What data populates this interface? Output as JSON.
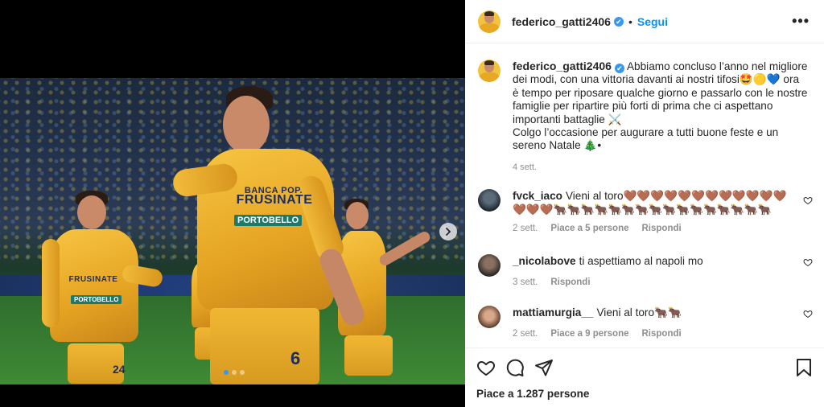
{
  "post": {
    "username": "federico_gatti2406",
    "follow_label": "Segui",
    "more_label": "•••",
    "separator": "•",
    "verified_mark": "✔",
    "caption": "Abbiamo concluso l’anno nel migliore dei modi, con una vittoria davanti ai nostri tifosi🤩🟡💙 ora è tempo per riposare qualche giorno e passarlo con le nostre famiglie per ripartire più forti di prima che ci aspettano importanti battaglie ⚔️",
    "caption_line2": "Colgo l’occasione per augurare a tutti buone feste e un sereno Natale 🎄•",
    "caption_time": "4 sett.",
    "likes_text": "Piace a 1.287 persone"
  },
  "photo": {
    "sponsor_top": "BANCA POP.",
    "sponsor_main": "FRUSINATE",
    "sponsor_sub": "PORTOBELLO",
    "player_number": "6",
    "left_player_number": "24",
    "carousel_dot_count": 3,
    "carousel_active_index": 0
  },
  "comments": [
    {
      "username": "fvck_iaco",
      "text": "Vieni al toro🤎🤎🤎🤎🤎🤎🤎🤎🤎🤎🤎🤎🤎🤎🤎🐂🐂🐂🐂🐂🐂🐂🐂🐂🐂🐂🐂🐂🐂🐂🐂",
      "time": "2 sett.",
      "likes": "Piace a 5 persone",
      "reply": "Rispondi"
    },
    {
      "username": "_nicolabove",
      "text": "ti aspettiamo al napoli mo",
      "time": "3 sett.",
      "likes": "",
      "reply": "Rispondi"
    },
    {
      "username": "mattiamurgia__",
      "text": "Vieni al toro🐂🐂",
      "time": "2 sett.",
      "likes": "Piace a 9 persone",
      "reply": "Rispondi"
    }
  ],
  "icons": {
    "like": "heart-icon",
    "comment": "comment-icon",
    "share": "share-icon",
    "save": "bookmark-icon",
    "next": "chevron-right-icon"
  },
  "colors": {
    "accent": "#0095f6",
    "verified": "#3897f0",
    "muted": "#8e8e8e"
  }
}
